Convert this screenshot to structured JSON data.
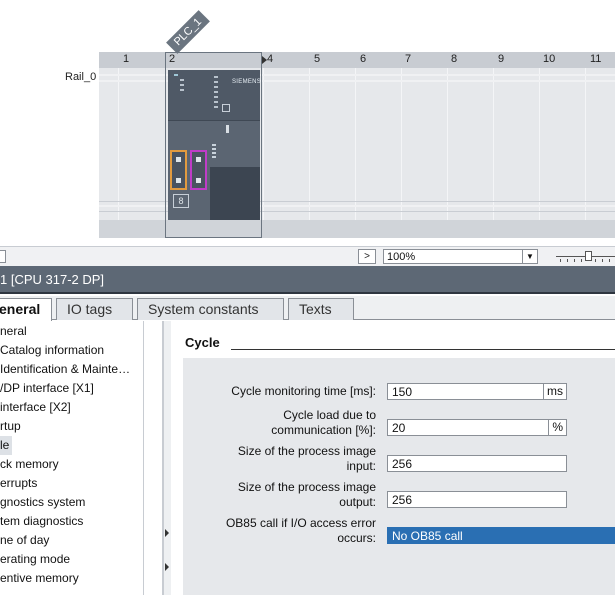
{
  "device_view": {
    "plc_tag": "PLC_1",
    "rail_label": "Rail_0",
    "slot_numbers": [
      "1",
      "2",
      "4",
      "5",
      "6",
      "7",
      "8",
      "9",
      "10",
      "11"
    ],
    "cpu_brand": "SIEMENS",
    "cpu_digit": "8"
  },
  "toolbar": {
    "scroll_right": ">",
    "zoom_value": "100%",
    "zoom_dropdown": "▼"
  },
  "properties": {
    "title": "1 [CPU 317-2 DP]"
  },
  "tabs": [
    {
      "label": "eneral",
      "active": true
    },
    {
      "label": "IO tags",
      "active": false
    },
    {
      "label": "System constants",
      "active": false
    },
    {
      "label": "Texts",
      "active": false
    }
  ],
  "nav": {
    "items": [
      "neral",
      "Catalog information",
      "Identification & Mainte…",
      "/DP interface [X1]",
      "interface [X2]",
      "rtup",
      "le",
      "ck memory",
      "errupts",
      "gnostics system",
      "tem diagnostics",
      "ne of day",
      "erating mode",
      "entive memory"
    ],
    "selected_index": 6
  },
  "cycle": {
    "section_title": "Cycle",
    "fields": [
      {
        "label": "Cycle monitoring time [ms]:",
        "value": "150",
        "unit": "ms"
      },
      {
        "label_line1": "Cycle load due to",
        "label_line2": "communication [%]:",
        "value": "20",
        "unit": "%"
      },
      {
        "label_line1": "Size of the process image",
        "label_line2": "input:",
        "value": "256"
      },
      {
        "label_line1": "Size of the process image",
        "label_line2": "output:",
        "value": "256"
      },
      {
        "label_line1": "OB85 call if I/O access error",
        "label_line2": "occurs:",
        "value": "No OB85 call"
      }
    ]
  },
  "colors": {
    "accent": "#2a6fb3",
    "header_bg": "#5d6875",
    "port_orange": "#e39b3f",
    "port_magenta": "#c03cc8"
  }
}
